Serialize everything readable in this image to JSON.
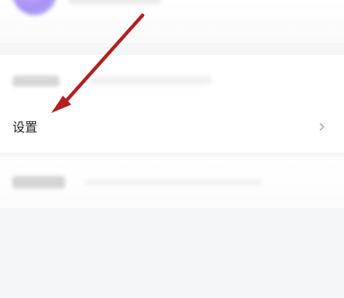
{
  "menu": {
    "settings_label": "设置"
  },
  "icons": {
    "chevron": "chevron-right-icon"
  },
  "colors": {
    "background": "#f5f6f8",
    "card": "#ffffff",
    "text": "#222222",
    "arrow": "#b51f1f",
    "avatar": "#a58ef7"
  }
}
